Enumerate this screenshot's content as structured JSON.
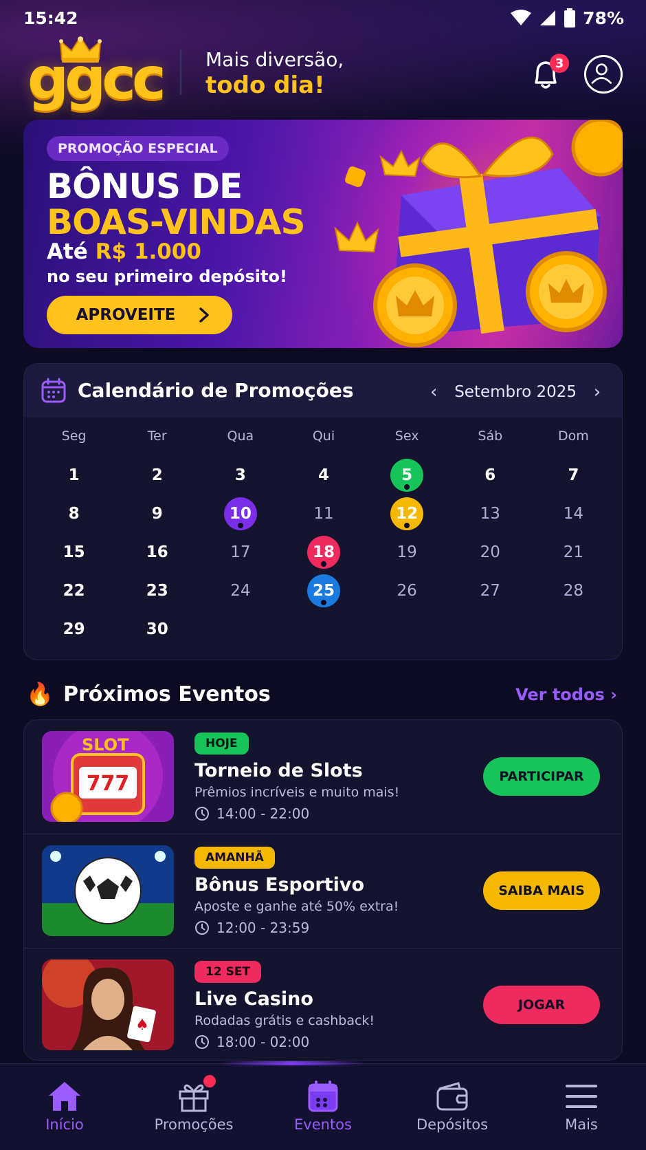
{
  "status_bar": {
    "time": "15:42",
    "battery": "78%"
  },
  "header": {
    "logo_text": "ggcc",
    "tagline_line1": "Mais diversão,",
    "tagline_line2": "todo dia!",
    "notification_count": "3"
  },
  "banner": {
    "pill": "PROMOÇÃO ESPECIAL",
    "title_line1": "BÔNUS DE",
    "title_line2": "BOAS-VINDAS",
    "upto_prefix": "Até",
    "upto_amount": "R$ 1.000",
    "subtitle": "no seu primeiro depósito!",
    "cta_label": "APROVEITE"
  },
  "calendar": {
    "title": "Calendário de Promoções",
    "month": "Setembro 2025",
    "weekdays": [
      "Seg",
      "Ter",
      "Qua",
      "Qui",
      "Sex",
      "Sáb",
      "Dom"
    ],
    "days": [
      {
        "d": "1"
      },
      {
        "d": "2"
      },
      {
        "d": "3"
      },
      {
        "d": "4"
      },
      {
        "d": "5",
        "color": "#16c45a"
      },
      {
        "d": "6"
      },
      {
        "d": "7"
      },
      {
        "d": "8"
      },
      {
        "d": "9"
      },
      {
        "d": "10",
        "color": "#7a2ee8"
      },
      {
        "d": "11",
        "dim": true
      },
      {
        "d": "12",
        "color": "#f5b800"
      },
      {
        "d": "13",
        "dim": true
      },
      {
        "d": "14",
        "dim": true
      },
      {
        "d": "15"
      },
      {
        "d": "16"
      },
      {
        "d": "17",
        "dim": true
      },
      {
        "d": "18",
        "color": "#ee2a5e"
      },
      {
        "d": "19",
        "dim": true
      },
      {
        "d": "20",
        "dim": true
      },
      {
        "d": "21",
        "dim": true
      },
      {
        "d": "22"
      },
      {
        "d": "23"
      },
      {
        "d": "24",
        "dim": true
      },
      {
        "d": "25",
        "color": "#1a7ae0"
      },
      {
        "d": "26",
        "dim": true
      },
      {
        "d": "27",
        "dim": true
      },
      {
        "d": "28",
        "dim": true
      },
      {
        "d": "29"
      },
      {
        "d": "30"
      }
    ]
  },
  "events": {
    "title": "Próximos Eventos",
    "see_all": "Ver todos",
    "items": [
      {
        "tag": "HOJE",
        "tag_color": "#16c45a",
        "name": "Torneio de Slots",
        "desc": "Prêmios incríveis e muito mais!",
        "time": "14:00 - 22:00",
        "button": "PARTICIPAR",
        "button_color": "#16c45a",
        "thumb_text": "SLOT"
      },
      {
        "tag": "AMANHÃ",
        "tag_color": "#f5b800",
        "name": "Bônus Esportivo",
        "desc": "Aposte e ganhe até 50% extra!",
        "time": "12:00 - 23:59",
        "button": "SAIBA MAIS",
        "button_color": "#f5b800"
      },
      {
        "tag": "12 SET",
        "tag_color": "#ee2a5e",
        "name": "Live Casino",
        "desc": "Rodadas grátis e cashback!",
        "time": "18:00 - 02:00",
        "button": "JOGAR",
        "button_color": "#ee2a5e"
      }
    ]
  },
  "nav": {
    "items": [
      {
        "label": "Início",
        "icon": "home-icon",
        "active": true
      },
      {
        "label": "Promoções",
        "icon": "gift-icon"
      },
      {
        "label": "Eventos",
        "icon": "calendar-icon",
        "active": true
      },
      {
        "label": "Depósitos",
        "icon": "wallet-icon"
      },
      {
        "label": "Mais",
        "icon": "menu-icon"
      }
    ]
  },
  "colors": {
    "accent": "#ffc21a",
    "purple": "#9a5cff",
    "background": "#0c0b22"
  }
}
